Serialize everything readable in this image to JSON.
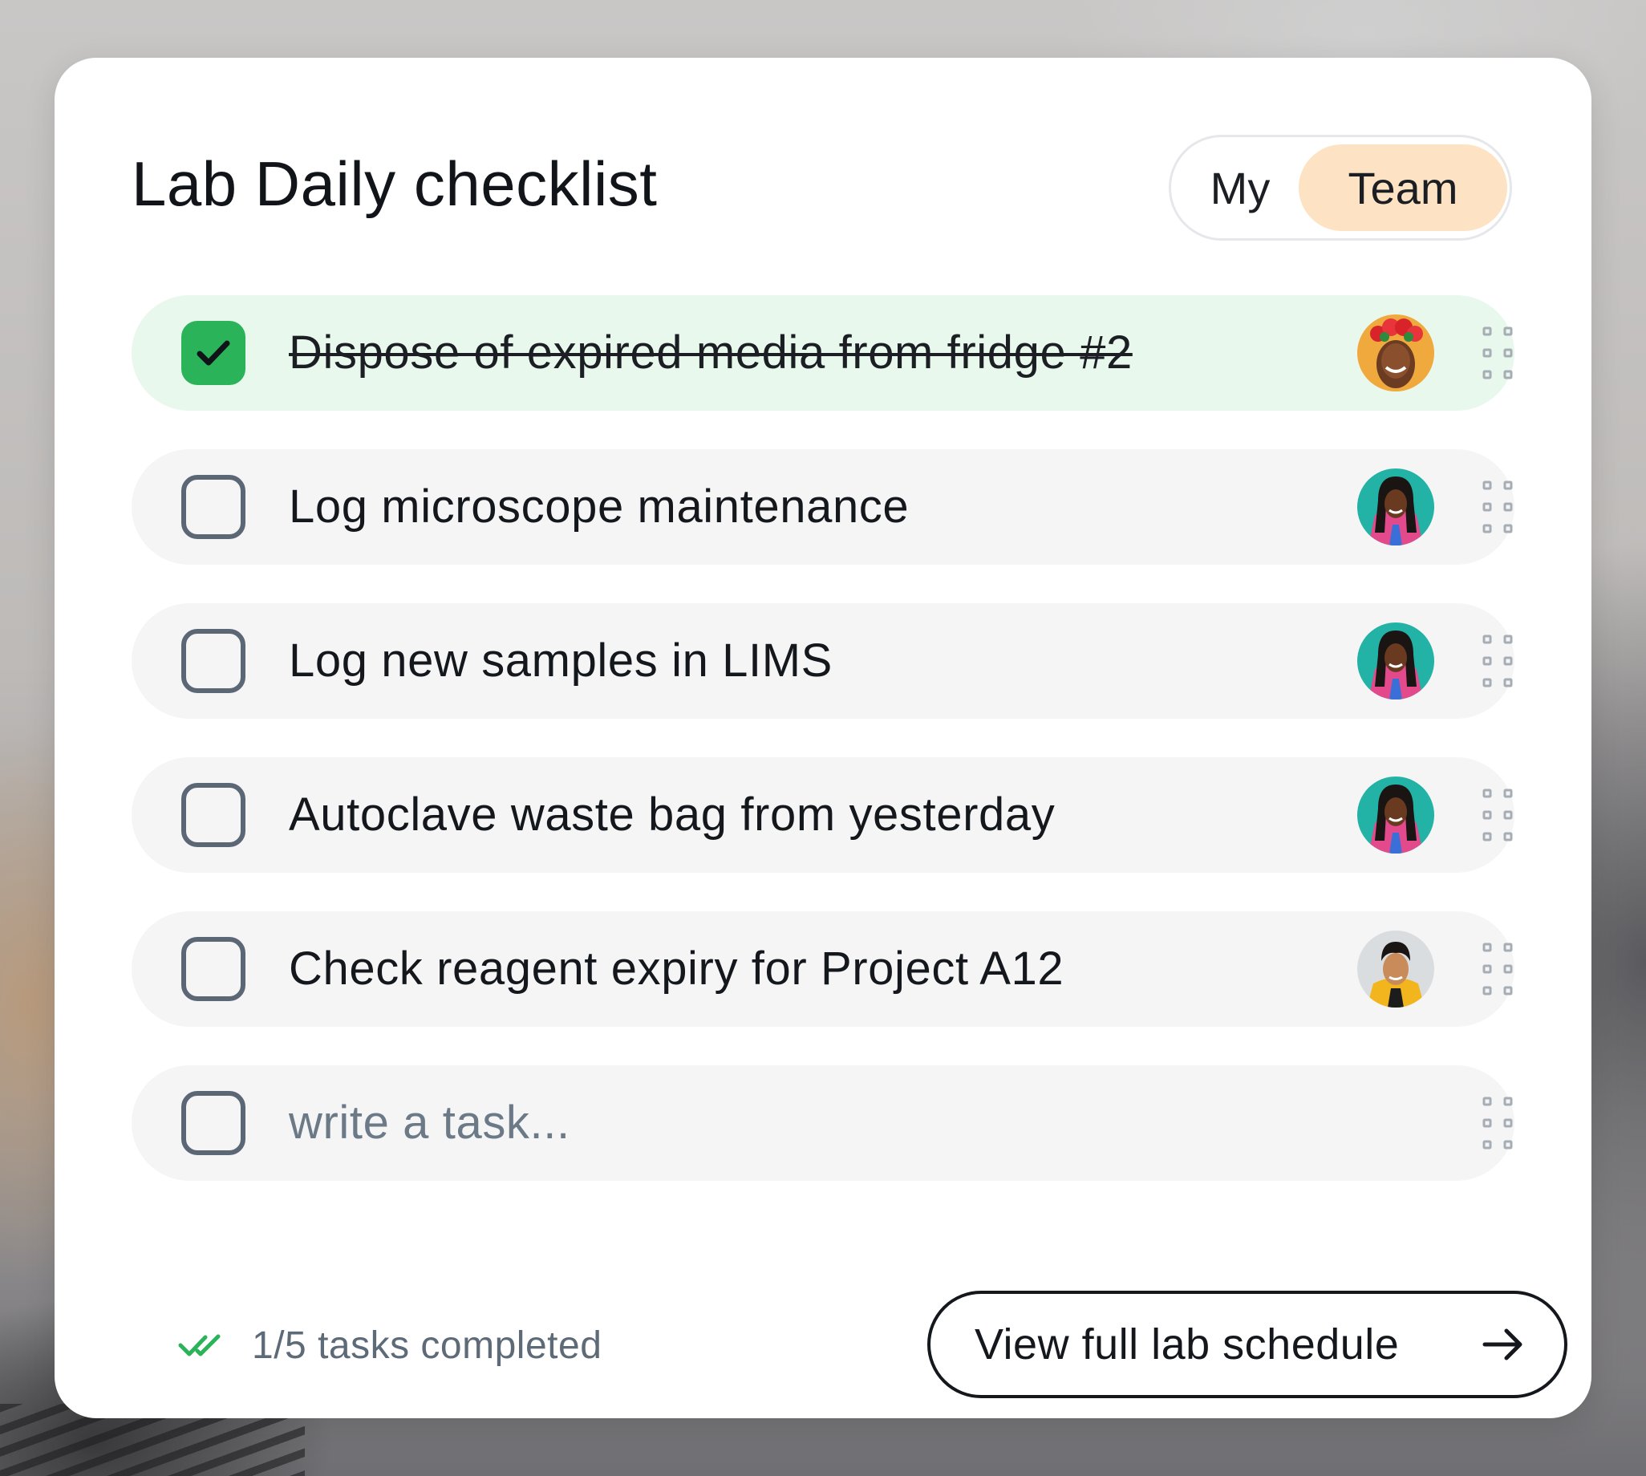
{
  "header": {
    "title": "Lab Daily checklist",
    "toggle": {
      "options": [
        "My",
        "Team"
      ],
      "selected": "Team"
    }
  },
  "tasks": [
    {
      "label": "Dispose of expired media from fridge #2",
      "completed": true,
      "avatar": "avatar-woman-flower-crown"
    },
    {
      "label": "Log microscope maintenance",
      "completed": false,
      "avatar": "avatar-woman-braids"
    },
    {
      "label": "Log new samples in LIMS",
      "completed": false,
      "avatar": "avatar-woman-braids"
    },
    {
      "label": "Autoclave waste bag from yesterday",
      "completed": false,
      "avatar": "avatar-woman-braids"
    },
    {
      "label": "Check reagent expiry for Project A12",
      "completed": false,
      "avatar": "avatar-man-curly-hair"
    }
  ],
  "new_task": {
    "placeholder": "write a task..."
  },
  "footer": {
    "status_text": "1/5 tasks completed",
    "status_icon": "double-check-icon",
    "button_label": "View full lab schedule",
    "button_icon": "arrow-right-icon"
  },
  "colors": {
    "done_row": "#e8f8ec",
    "checked_box": "#2bb35a",
    "toggle_active": "#fde3c3",
    "row_background": "#f5f5f6"
  }
}
